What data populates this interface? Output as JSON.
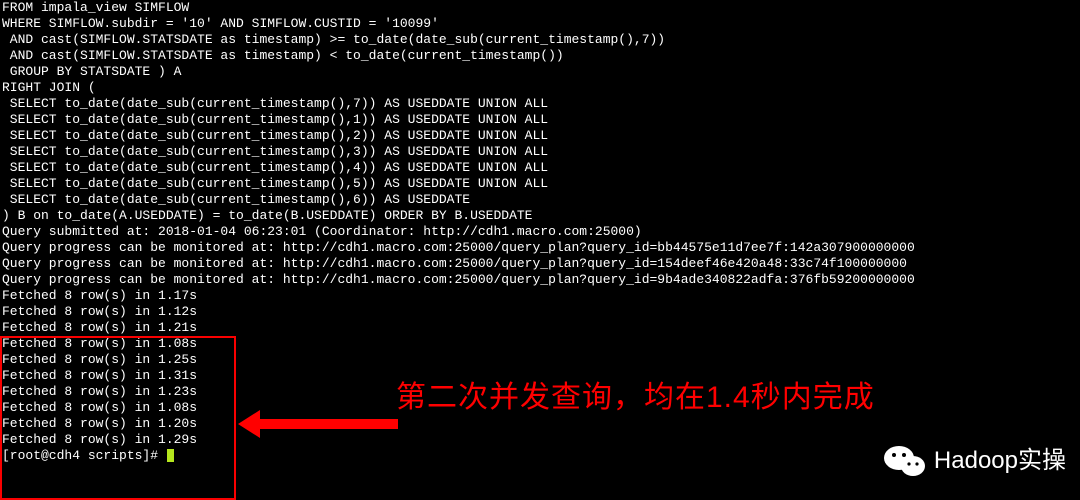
{
  "sql_lines": [
    "FROM impala_view SIMFLOW",
    "WHERE SIMFLOW.subdir = '10' AND SIMFLOW.CUSTID = '10099'",
    " AND cast(SIMFLOW.STATSDATE as timestamp) >= to_date(date_sub(current_timestamp(),7))",
    " AND cast(SIMFLOW.STATSDATE as timestamp) < to_date(current_timestamp())",
    " GROUP BY STATSDATE ) A",
    "RIGHT JOIN (",
    " SELECT to_date(date_sub(current_timestamp(),7)) AS USEDDATE UNION ALL",
    " SELECT to_date(date_sub(current_timestamp(),1)) AS USEDDATE UNION ALL",
    " SELECT to_date(date_sub(current_timestamp(),2)) AS USEDDATE UNION ALL",
    " SELECT to_date(date_sub(current_timestamp(),3)) AS USEDDATE UNION ALL",
    " SELECT to_date(date_sub(current_timestamp(),4)) AS USEDDATE UNION ALL",
    " SELECT to_date(date_sub(current_timestamp(),5)) AS USEDDATE UNION ALL",
    " SELECT to_date(date_sub(current_timestamp(),6)) AS USEDDATE",
    ") B on to_date(A.USEDDATE) = to_date(B.USEDDATE) ORDER BY B.USEDDATE"
  ],
  "status_lines": [
    "Query submitted at: 2018-01-04 06:23:01 (Coordinator: http://cdh1.macro.com:25000)",
    "Query progress can be monitored at: http://cdh1.macro.com:25000/query_plan?query_id=bb44575e11d7ee7f:142a307900000000",
    "Query progress can be monitored at: http://cdh1.macro.com:25000/query_plan?query_id=154deef46e420a48:33c74f100000000",
    "Query progress can be monitored at: http://cdh1.macro.com:25000/query_plan?query_id=9b4ade340822adfa:376fb59200000000"
  ],
  "fetched": [
    {
      "rows": 8,
      "seconds": "1.17s"
    },
    {
      "rows": 8,
      "seconds": "1.12s"
    },
    {
      "rows": 8,
      "seconds": "1.21s"
    },
    {
      "rows": 8,
      "seconds": "1.08s"
    },
    {
      "rows": 8,
      "seconds": "1.25s"
    },
    {
      "rows": 8,
      "seconds": "1.31s"
    },
    {
      "rows": 8,
      "seconds": "1.23s"
    },
    {
      "rows": 8,
      "seconds": "1.08s"
    },
    {
      "rows": 8,
      "seconds": "1.20s"
    },
    {
      "rows": 8,
      "seconds": "1.29s"
    }
  ],
  "prompt": {
    "user": "root",
    "host": "cdh4",
    "cwd": "scripts",
    "symbol": "#"
  },
  "annotation": {
    "text": "第二次并发查询，均在1.4秒内完成"
  },
  "watermark": {
    "label": "Hadoop实操"
  }
}
